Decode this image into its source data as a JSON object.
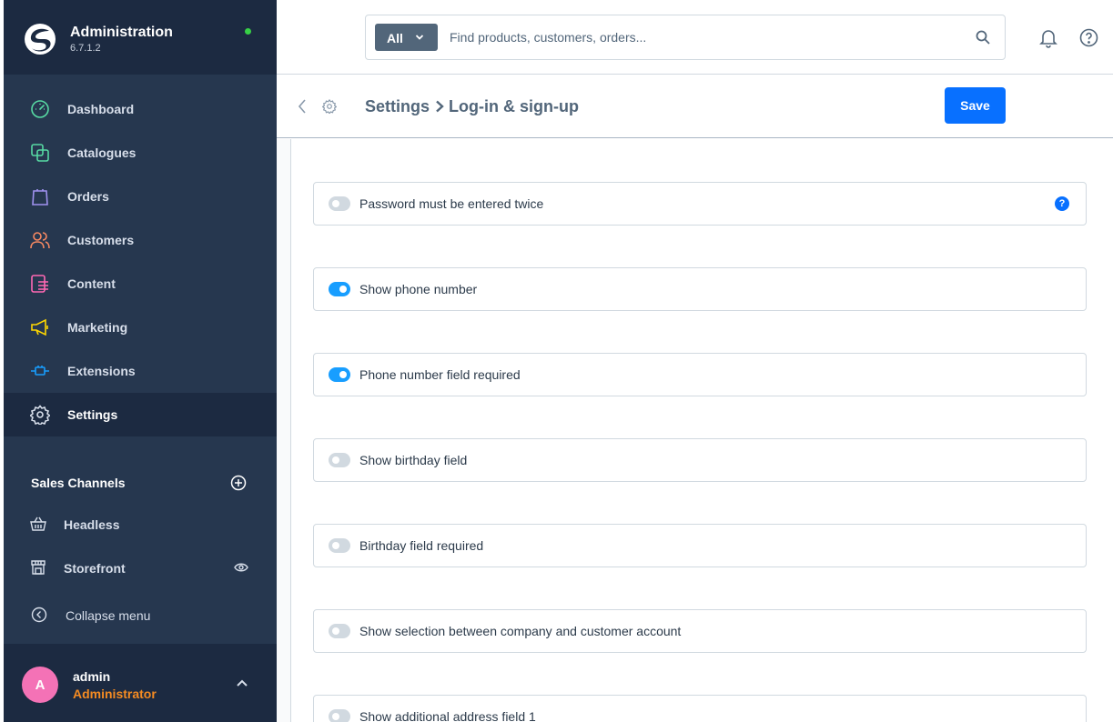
{
  "brand": {
    "title": "Administration",
    "version": "6.7.1.2"
  },
  "nav": [
    {
      "label": "Dashboard",
      "icon": "dashboard-icon",
      "color": "#57d9a3"
    },
    {
      "label": "Catalogues",
      "icon": "catalogues-icon",
      "color": "#57d9a3"
    },
    {
      "label": "Orders",
      "icon": "orders-icon",
      "color": "#a092f0"
    },
    {
      "label": "Customers",
      "icon": "customers-icon",
      "color": "#f88962"
    },
    {
      "label": "Content",
      "icon": "content-icon",
      "color": "#ff68b4"
    },
    {
      "label": "Marketing",
      "icon": "marketing-icon",
      "color": "#ffd700"
    },
    {
      "label": "Extensions",
      "icon": "extensions-icon",
      "color": "#189eff"
    },
    {
      "label": "Settings",
      "icon": "settings-icon",
      "color": "#d7deea"
    }
  ],
  "sales_channels": {
    "heading": "Sales Channels",
    "items": [
      {
        "label": "Headless",
        "icon": "basket-icon"
      },
      {
        "label": "Storefront",
        "icon": "storefront-icon"
      }
    ]
  },
  "collapse_label": "Collapse menu",
  "user": {
    "initial": "A",
    "name": "admin",
    "role": "Administrator"
  },
  "search": {
    "scope": "All",
    "placeholder": "Find products, customers, orders..."
  },
  "breadcrumb": {
    "parent": "Settings",
    "current": "Log-in & sign-up"
  },
  "save_label": "Save",
  "fields": [
    {
      "label": "Password must be entered twice",
      "on": false,
      "help": "?"
    },
    {
      "label": "Show phone number",
      "on": true
    },
    {
      "label": "Phone number field required",
      "on": true
    },
    {
      "label": "Show birthday field",
      "on": false
    },
    {
      "label": "Birthday field required",
      "on": false
    },
    {
      "label": "Show selection between company and customer account",
      "on": false
    },
    {
      "label": "Show additional address field 1",
      "on": false
    }
  ],
  "colors": {
    "sidebar": "#26374f",
    "sidebar_dark": "#1c2a41",
    "accent": "#0870ff",
    "toggle_on": "#189eff",
    "role": "#f48b22"
  }
}
